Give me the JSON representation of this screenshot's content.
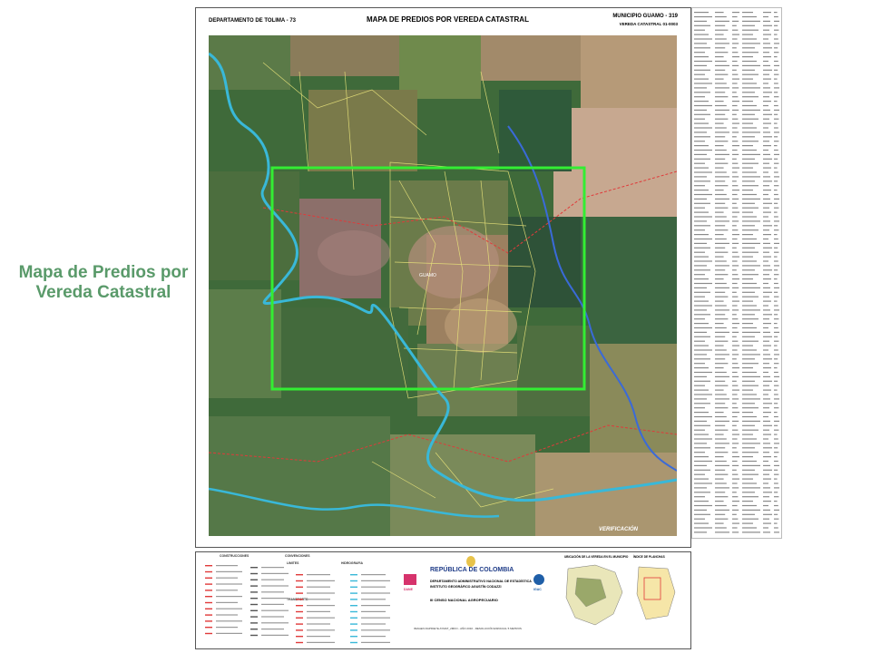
{
  "side_caption": {
    "line1": "Mapa de Predios por",
    "line2": "Vereda Catastral"
  },
  "header": {
    "department": "DEPARTAMENTO DE TOLIMA - 73",
    "title": "MAPA DE PREDIOS POR VEREDA CATASTRAL",
    "municipality": "MUNICIPIO GUAMO - 319",
    "vereda": "VEREDA CATASTRAL 01-0003"
  },
  "map": {
    "place_label": "GUAMO",
    "imagery_note": "VERIFICACIÓN",
    "colors": {
      "highlight": "#33ee33",
      "river": "#39b8d8",
      "parcel_line": "#e8e37a",
      "boundary": "#e03a3a"
    }
  },
  "legend": {
    "conventions_title": "CONVENCIONES",
    "limits_title": "LIMITES",
    "hydrography_title": "HIDROGRAFIA",
    "transport_title": "TRANSPORTE",
    "constructions_title": "CONSTRUCCIONES",
    "republic": "REPÚBLICA DE COLOMBIA",
    "dane_org": "DEPARTAMENTO ADMINISTRATIVO NACIONAL DE ESTADÍSTICA",
    "igac_org": "INSTITUTO GEOGRÁFICO AGUSTÍN CODAZZI",
    "censo": "III CENSO NACIONAL AGROPECUARIO",
    "image_note": "IMAGEN RAPIDEYE AYMAT_2MKO - AÑO 2010 - RESOLUCIÓN ESPACIAL 5 METROS",
    "location_title": "UBICACIÓN DE LA VEREDA EN EL MUNICIPIO",
    "index_title": "ÍNDICE DE PLANCHAS",
    "dane_logo": "DANE",
    "igac_logo": "IGAC"
  }
}
